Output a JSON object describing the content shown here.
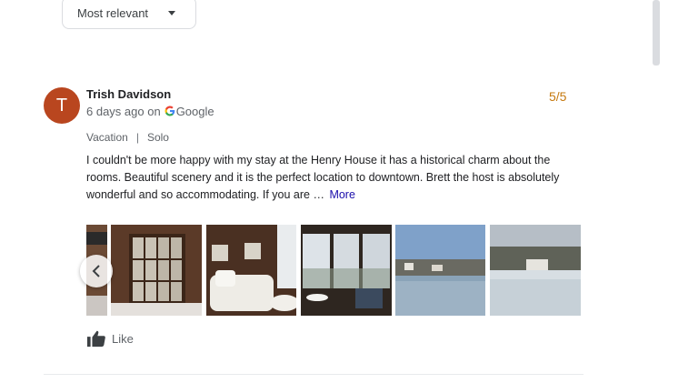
{
  "sort": {
    "label": "Most relevant",
    "icon": "caret-down-icon"
  },
  "review": {
    "avatar_letter": "T",
    "reviewer_name": "Trish Davidson",
    "time_ago": "6 days ago on",
    "source": "Google",
    "rating": "5/5",
    "trip_type": "Vacation",
    "separator": "|",
    "travel_group": "Solo",
    "text": "I couldn't be more happy with my stay at the Henry House it has a historical charm about the rooms. Beautiful scenery and it is the perfect location to downtown. Brett the host is absolutely wonderful and so accommodating. If you are …",
    "more_label": "More",
    "like_label": "Like"
  },
  "colors": {
    "avatar": "#b9461f",
    "rating": "#c5790e",
    "link": "#1a0dab",
    "google_blue": "#4285f4"
  }
}
